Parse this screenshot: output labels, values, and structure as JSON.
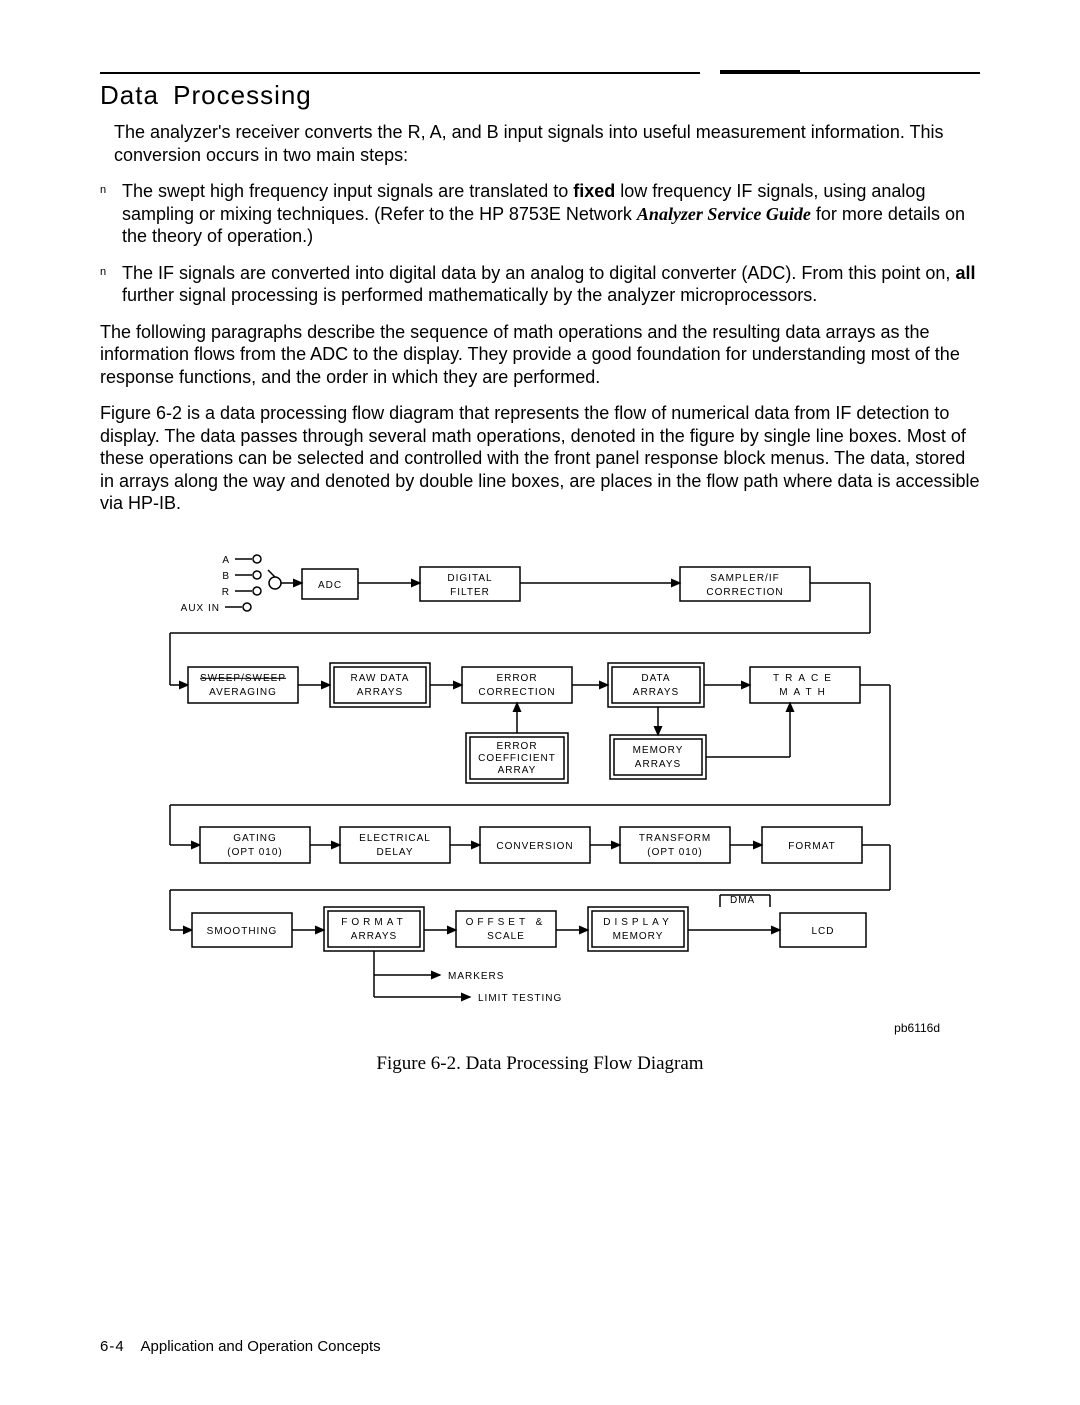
{
  "section_title": "Data Processing",
  "intro": "The analyzer's receiver converts the R, A, and B input signals into useful measurement information. This conversion occurs in two main steps:",
  "bullets": [
    {
      "pre": "The swept high frequency input signals are translated to ",
      "b1": "fixed",
      "mid1": " low frequency IF signals, using analog sampling or mixing techniques. (Refer to the ",
      "plain": "HP 8753E Network ",
      "ib1": "Analyzer Service Guide",
      "post": " for more details on the theory of operation.)"
    },
    {
      "pre": "The IF signals are converted into digital data by an analog to digital converter (ADC). From this point on, ",
      "b1": "all",
      "mid1": " further signal processing is performed mathematically by the analyzer microprocessors.",
      "plain": "",
      "ib1": "",
      "post": ""
    }
  ],
  "para1": "The following paragraphs describe the sequence of math operations and the resulting data arrays as the information flows from the ADC to the display. They provide a good foundation for understanding most of the response functions, and the order in which they are performed.",
  "para2": "Figure 6-2 is a data processing flow diagram that represents the flow of numerical data from IF detection to display. The data passes through several math operations, denoted in the figure by single line boxes. Most of these operations can be selected and controlled with the front panel response block menus. The data, stored in arrays along the way and denoted by double line boxes, are places in the flow path where data is accessible via HP-IB.",
  "diagram": {
    "inputs": {
      "A": "A",
      "B": "B",
      "R": "R",
      "AUX": "AUX IN"
    },
    "blocks": {
      "adc": "ADC",
      "digital_filter_l1": "DIGITAL",
      "digital_filter_l2": "FILTER",
      "sampler_l1": "SAMPLER/IF",
      "sampler_l2": "CORRECTION",
      "sweep_l1": "SWEEP/SWEEP",
      "sweep_l2": "AVERAGING",
      "raw_l1": "RAW DATA",
      "raw_l2": "ARRAYS",
      "error_l1": "ERROR",
      "error_l2": "CORRECTION",
      "data_l1": "DATA",
      "data_l2": "ARRAYS",
      "trace_l1": "TRACE",
      "trace_l2": "MATH",
      "errcoef_l1": "ERROR",
      "errcoef_l2": "COEFFICIENT",
      "errcoef_l3": "ARRAY",
      "mem_l1": "MEMORY",
      "mem_l2": "ARRAYS",
      "gating_l1": "GATING",
      "gating_l2": "(OPT 010)",
      "edelay_l1": "ELECTRICAL",
      "edelay_l2": "DELAY",
      "conv": "CONVERSION",
      "trans_l1": "TRANSFORM",
      "trans_l2": "(OPT 010)",
      "format": "FORMAT",
      "smooth": "SMOOTHING",
      "farr_l1": "FORMAT",
      "farr_l2": "ARRAYS",
      "offset_l1": "OFFSET &",
      "offset_l2": "SCALE",
      "disp_l1": "DISPLAY",
      "disp_l2": "MEMORY",
      "lcd": "LCD",
      "dma": "DMA",
      "markers": "MARKERS",
      "limit": "LIMIT TESTING"
    },
    "id": "pb6116d"
  },
  "caption": "Figure 6-2. Data Processing Flow Diagram",
  "footer": {
    "pageno": "6-4",
    "label": "Application and Operation Concepts"
  }
}
